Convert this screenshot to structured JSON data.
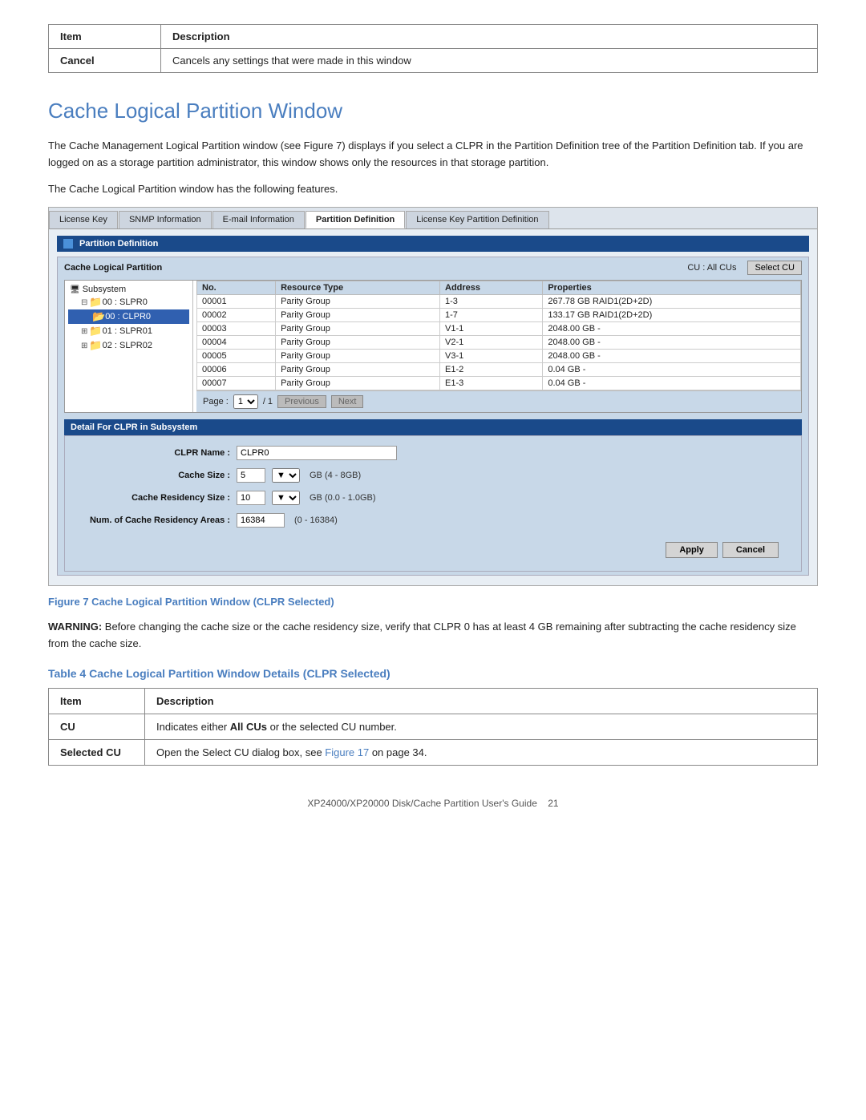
{
  "top_table": {
    "col1": "Item",
    "col2": "Description",
    "rows": [
      {
        "item": "Cancel",
        "description": "Cancels any settings that were made in this window"
      }
    ]
  },
  "section_heading": "Cache Logical Partition Window",
  "body_text_1": "The Cache Management Logical Partition window (see Figure 7) displays if you select a CLPR in the Partition Definition tree of the Partition Definition tab. If you are logged on as a storage partition administrator, this window shows only the resources in that storage partition.",
  "body_text_2": "The Cache Logical Partition window has the following features.",
  "ui": {
    "tabs": [
      {
        "label": "License Key",
        "active": false
      },
      {
        "label": "SNMP Information",
        "active": false
      },
      {
        "label": "E-mail Information",
        "active": false
      },
      {
        "label": "Partition Definition",
        "active": true
      },
      {
        "label": "License Key Partition Definition",
        "active": false
      }
    ],
    "panel_title": "Partition Definition",
    "clp_title": "Cache Logical Partition",
    "cu_label": "CU : All CUs",
    "select_cu_btn": "Select CU",
    "tree": {
      "items": [
        {
          "label": "Subsystem",
          "level": 0,
          "icon": "subsystem",
          "selected": false
        },
        {
          "label": "00 : SLPR0",
          "level": 1,
          "icon": "folder",
          "selected": false,
          "expanded": true
        },
        {
          "label": "00 : CLPR0",
          "level": 2,
          "icon": "folder-blue",
          "selected": true
        },
        {
          "label": "01 : SLPR01",
          "level": 1,
          "icon": "folder",
          "selected": false,
          "expanded": false
        },
        {
          "label": "02 : SLPR02",
          "level": 1,
          "icon": "folder",
          "selected": false,
          "expanded": false
        }
      ]
    },
    "table": {
      "headers": [
        "No.",
        "Resource Type",
        "Address",
        "Properties"
      ],
      "rows": [
        {
          "no": "00001",
          "type": "Parity Group",
          "address": "1-3",
          "properties": "267.78 GB RAID1(2D+2D)"
        },
        {
          "no": "00002",
          "type": "Parity Group",
          "address": "1-7",
          "properties": "133.17 GB RAID1(2D+2D)"
        },
        {
          "no": "00003",
          "type": "Parity Group",
          "address": "V1-1",
          "properties": "2048.00 GB -"
        },
        {
          "no": "00004",
          "type": "Parity Group",
          "address": "V2-1",
          "properties": "2048.00 GB -"
        },
        {
          "no": "00005",
          "type": "Parity Group",
          "address": "V3-1",
          "properties": "2048.00 GB -"
        },
        {
          "no": "00006",
          "type": "Parity Group",
          "address": "E1-2",
          "properties": "0.04 GB -"
        },
        {
          "no": "00007",
          "type": "Parity Group",
          "address": "E1-3",
          "properties": "0.04 GB -"
        }
      ]
    },
    "pagination": {
      "page_label": "Page :",
      "current": "1",
      "total": "/ 1",
      "prev_btn": "Previous",
      "next_btn": "Next"
    },
    "detail_panel_title": "Detail For CLPR in Subsystem",
    "detail_fields": {
      "clpr_name_label": "CLPR Name :",
      "clpr_name_value": "CLPR0",
      "cache_size_label": "Cache Size :",
      "cache_size_value": "5",
      "cache_size_hint": "GB (4 - 8GB)",
      "cache_residency_label": "Cache Residency Size :",
      "cache_residency_value": "10",
      "cache_residency_hint": "GB (0.0 - 1.0GB)",
      "num_areas_label": "Num. of Cache Residency Areas :",
      "num_areas_value": "16384",
      "num_areas_hint": "(0 - 16384)"
    },
    "apply_btn": "Apply",
    "cancel_btn": "Cancel"
  },
  "fig_caption": "Figure 7 Cache Logical Partition Window (CLPR Selected)",
  "warning": {
    "prefix": "WARNING:",
    "text": " Before changing the cache size or the cache residency size, verify that CLPR 0 has at least 4 GB remaining after subtracting the cache residency size from the cache size."
  },
  "table4_heading": "Table 4 Cache Logical Partition Window Details (CLPR Selected)",
  "bottom_table": {
    "col1": "Item",
    "col2": "Description",
    "rows": [
      {
        "item": "CU",
        "description_before": "Indicates either ",
        "description_bold": "All CUs",
        "description_after": " or the selected CU number."
      },
      {
        "item": "Selected CU",
        "description_before": "Open the Select CU dialog box, see ",
        "description_link": "Figure 17",
        "description_after": " on page 34."
      }
    ]
  },
  "footer": {
    "text": "XP24000/XP20000 Disk/Cache Partition User's Guide",
    "page": "21"
  }
}
